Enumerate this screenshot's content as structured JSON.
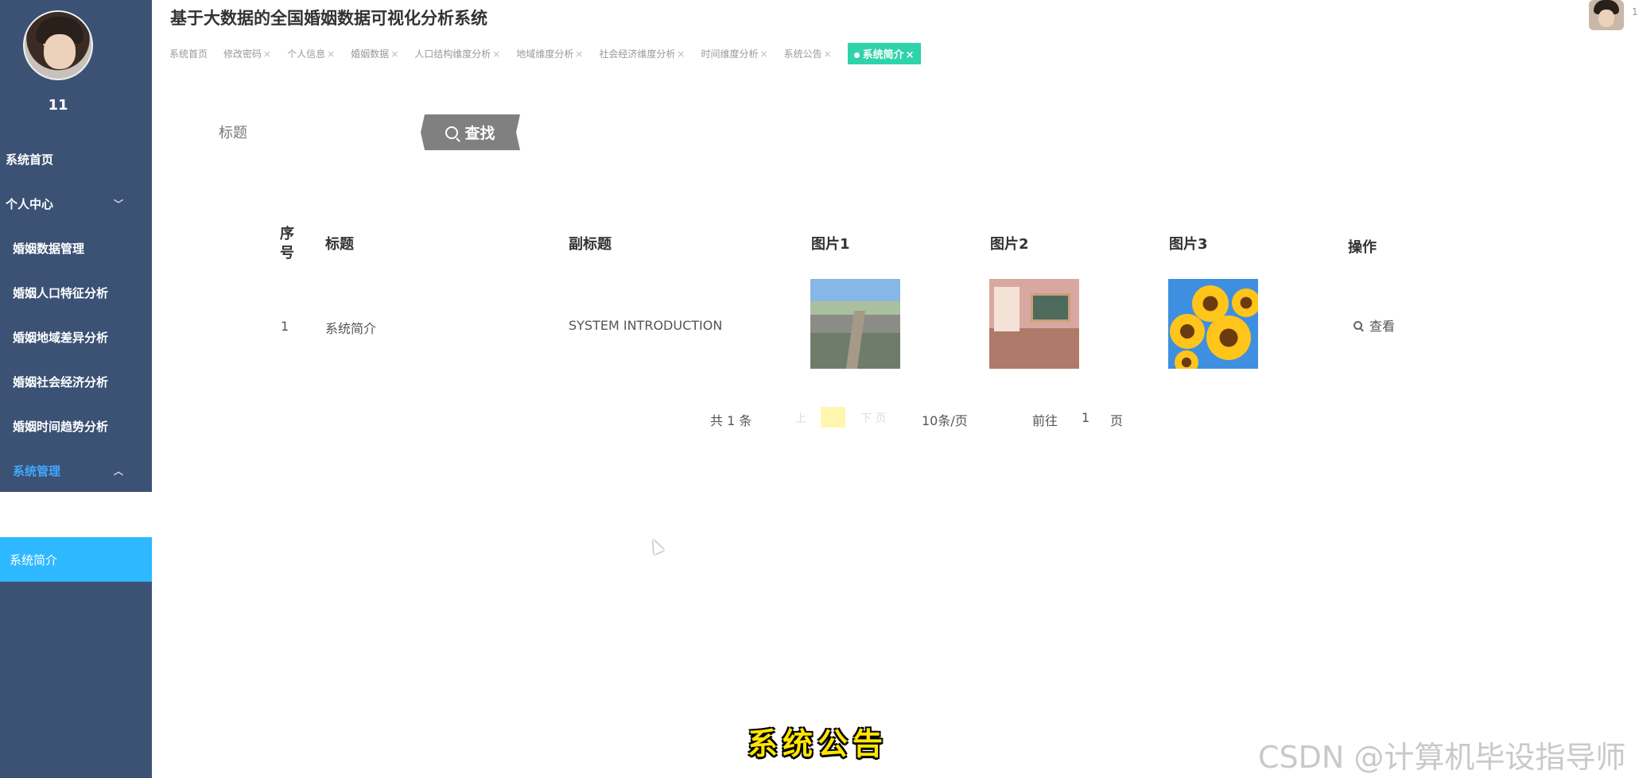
{
  "app": {
    "title": "基于大数据的全国婚姻数据可视化分析系统"
  },
  "user": {
    "name": "11",
    "header_label": "1"
  },
  "sidebar": {
    "items": [
      {
        "label": "系统首页"
      },
      {
        "label": "个人中心",
        "chevron": "chevron-down-icon"
      },
      {
        "label": "婚姻数据管理"
      },
      {
        "label": "婚姻人口特征分析"
      },
      {
        "label": "婚姻地域差异分析"
      },
      {
        "label": "婚姻社会经济分析"
      },
      {
        "label": "婚姻时间趋势分析"
      },
      {
        "label": "系统管理",
        "chevron": "chevron-up-icon"
      },
      {
        "label": "系统简介"
      }
    ]
  },
  "tabs": [
    {
      "label": "系统首页",
      "close": ""
    },
    {
      "label": "修改密码",
      "close": "×"
    },
    {
      "label": "个人信息",
      "close": "×"
    },
    {
      "label": "婚姻数据",
      "close": "×"
    },
    {
      "label": "人口结构维度分析",
      "close": "×"
    },
    {
      "label": "地域维度分析",
      "close": "×"
    },
    {
      "label": "社会经济维度分析",
      "close": "×"
    },
    {
      "label": "时间维度分析",
      "close": "×"
    },
    {
      "label": "系统公告",
      "close": "×"
    },
    {
      "label": "系统简介",
      "close": "×"
    }
  ],
  "search": {
    "label": "标题",
    "placeholder": "",
    "button": "查找"
  },
  "table": {
    "columns": {
      "no": "序号",
      "title": "标题",
      "subtitle": "副标题",
      "img1": "图片1",
      "img2": "图片2",
      "img3": "图片3",
      "action": "操作"
    },
    "rows": [
      {
        "no": "1",
        "title": "系统简介",
        "subtitle": "SYSTEM INTRODUCTION",
        "action": "查看"
      }
    ]
  },
  "pagination": {
    "total": "共 1 条",
    "prev_faint": "上",
    "current": "1",
    "next_faint": "下 页",
    "size": "10条/页",
    "goto": "前往",
    "goto_value": "1",
    "page_unit": "页"
  },
  "overlay": {
    "caption": "系统公告",
    "watermark": "CSDN @计算机毕设指导师"
  },
  "colors": {
    "sidebar": "#3b5275",
    "selected": "#2eb8ff",
    "active_tab": "#2ed3a9",
    "search_button": "#808080"
  }
}
